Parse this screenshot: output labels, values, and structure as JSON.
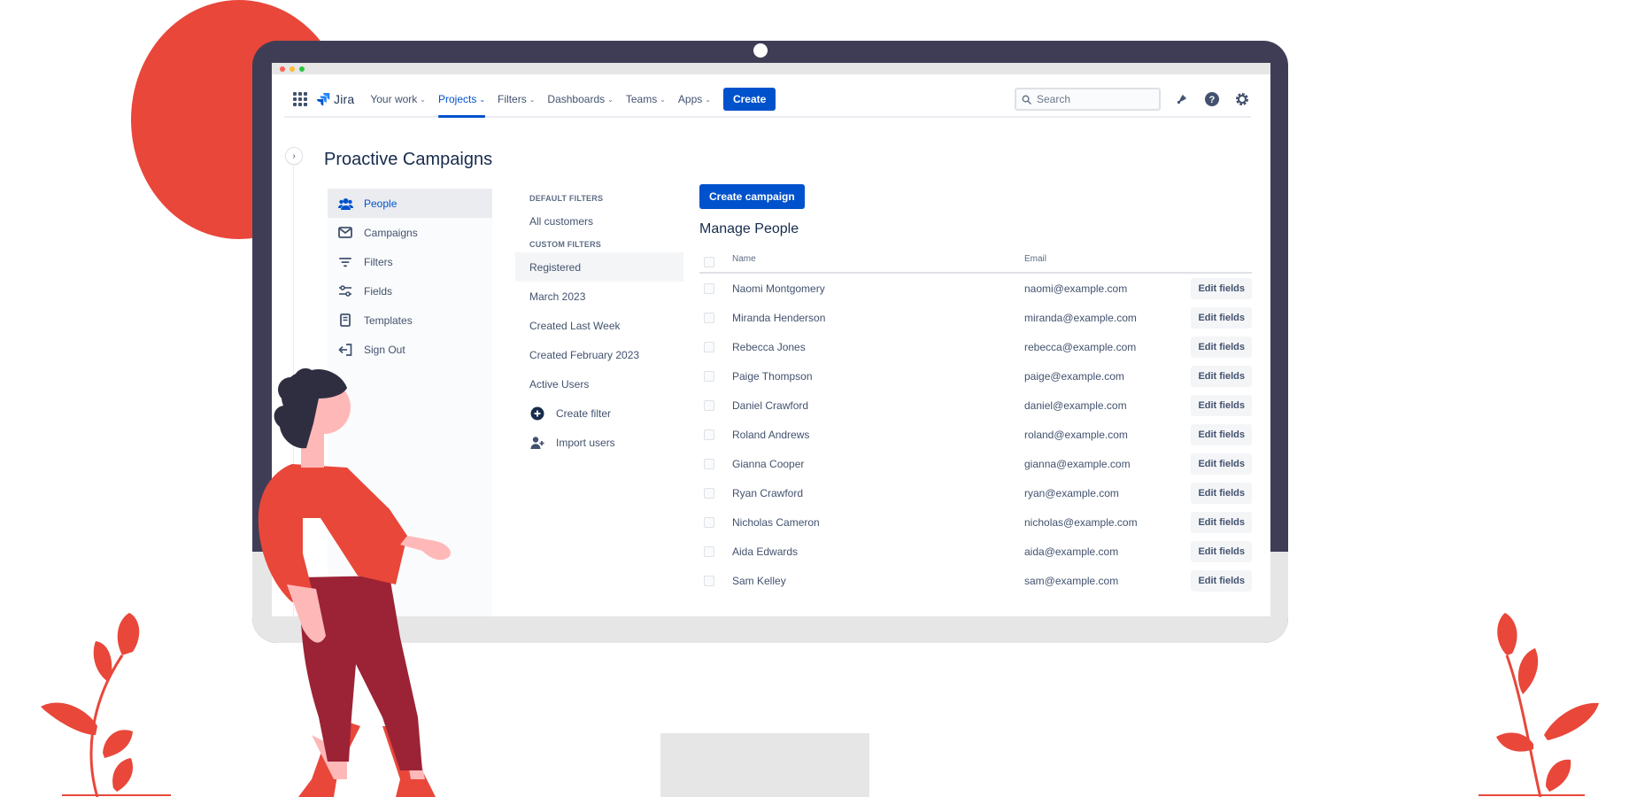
{
  "app": {
    "name": "Jira"
  },
  "topnav": {
    "items": [
      {
        "label": "Your work"
      },
      {
        "label": "Projects"
      },
      {
        "label": "Filters"
      },
      {
        "label": "Dashboards"
      },
      {
        "label": "Teams"
      },
      {
        "label": "Apps"
      }
    ],
    "create_label": "Create",
    "search_placeholder": "Search",
    "icons": [
      "notifications-icon",
      "help-icon",
      "settings-icon"
    ],
    "accent_color": "#0052CC"
  },
  "page": {
    "title": "Proactive Campaigns"
  },
  "sidebar": {
    "items": [
      {
        "label": "People",
        "icon": "people-icon"
      },
      {
        "label": "Campaigns",
        "icon": "mail-icon"
      },
      {
        "label": "Filters",
        "icon": "filter-icon"
      },
      {
        "label": "Fields",
        "icon": "sliders-icon"
      },
      {
        "label": "Templates",
        "icon": "document-icon"
      },
      {
        "label": "Sign Out",
        "icon": "sign-out-icon"
      }
    ]
  },
  "filters": {
    "default_heading": "DEFAULT FILTERS",
    "default_items": [
      "All customers"
    ],
    "custom_heading": "CUSTOM FILTERS",
    "custom_items": [
      "Registered",
      "March 2023",
      "Created Last Week",
      "Created February 2023",
      "Active Users"
    ],
    "actions": [
      {
        "label": "Create filter",
        "icon": "add-circle-icon"
      },
      {
        "label": "Import users",
        "icon": "add-user-icon"
      }
    ]
  },
  "main": {
    "create_campaign_label": "Create campaign",
    "section_title": "Manage People",
    "columns": {
      "name": "Name",
      "email": "Email"
    },
    "rows": [
      {
        "name": "Naomi Montgomery",
        "email": "naomi@example.com"
      },
      {
        "name": "Miranda Henderson",
        "email": "miranda@example.com"
      },
      {
        "name": "Rebecca Jones",
        "email": "rebecca@example.com"
      },
      {
        "name": "Paige Thompson",
        "email": "paige@example.com"
      },
      {
        "name": "Daniel Crawford",
        "email": "daniel@example.com"
      },
      {
        "name": "Roland Andrews",
        "email": "roland@example.com"
      },
      {
        "name": "Gianna Cooper",
        "email": "gianna@example.com"
      },
      {
        "name": "Ryan Crawford",
        "email": "ryan@example.com"
      },
      {
        "name": "Nicholas Cameron",
        "email": "nicholas@example.com"
      },
      {
        "name": "Aida Edwards",
        "email": "aida@example.com"
      },
      {
        "name": "Sam Kelley",
        "email": "sam@example.com"
      }
    ],
    "row_action_label": "Edit fields"
  }
}
